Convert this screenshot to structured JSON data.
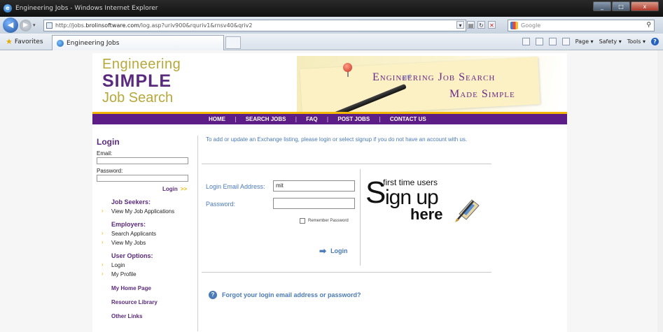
{
  "window": {
    "title": "Engineering Jobs - Windows Internet Explorer",
    "min": "_",
    "max": "□",
    "close": "x"
  },
  "address": {
    "url_prefix": "http://jobs.",
    "url_host": "brolinsoftware.com",
    "url_path": "/log.asp?uriv900&rquriv1&rnsv40&qriv2"
  },
  "search": {
    "placeholder": "Google"
  },
  "favbar": {
    "favorites": "Favorites",
    "tab_title": "Engineering Jobs",
    "page": "Page ▾",
    "safety": "Safety ▾",
    "tools": "Tools ▾"
  },
  "logo": {
    "line1": "Engineering",
    "line2": "SIMPLE",
    "line3": "Job Search"
  },
  "banner": {
    "line1": "Engineering Job Search",
    "line2": "Made Simple"
  },
  "nav": {
    "items": [
      "HOME",
      "SEARCH JOBS",
      "FAQ",
      "POST JOBS",
      "CONTACT US"
    ]
  },
  "sidebar": {
    "title": "Login",
    "email_label": "Email:",
    "password_label": "Password:",
    "login_link": "Login",
    "job_seekers": "Job Seekers:",
    "job_seekers_items": [
      "View My Job Applications"
    ],
    "employers": "Employers:",
    "employers_items": [
      "Search Applicants",
      "View My Jobs"
    ],
    "user_options": "User Options:",
    "user_options_items": [
      "Login",
      "My Profile"
    ],
    "my_home_page": "My Home Page",
    "resource_library": "Resource Library",
    "other_links": "Other Links"
  },
  "main": {
    "intro": "To add or update an Exchange listing, please login or select signup if you do not have an account with us.",
    "email_label": "Login Email Address:",
    "email_value": "mit",
    "password_label": "Password:",
    "remember": "Remember Password",
    "login_button": "Login",
    "signup_first": "first time users",
    "signup_S": "S",
    "signup_rest": "ign up",
    "signup_here": "here",
    "forgot": "Forgot your login email address or password?"
  },
  "colors": {
    "brand_purple": "#5d1d86",
    "brand_gold": "#f2b705",
    "link_blue": "#4a7ab8"
  }
}
